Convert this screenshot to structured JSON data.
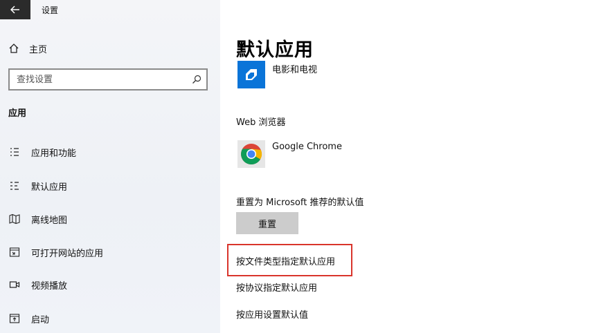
{
  "window": {
    "title": "设置",
    "back_icon": "arrow-left-icon"
  },
  "sidebar": {
    "home_label": "主页",
    "search": {
      "placeholder": "查找设置",
      "value": ""
    },
    "section_title": "应用",
    "items": [
      {
        "id": "apps-features",
        "label": "应用和功能",
        "icon": "list-icon"
      },
      {
        "id": "default-apps",
        "label": "默认应用",
        "icon": "default-apps-icon",
        "active": true
      },
      {
        "id": "offline-maps",
        "label": "离线地图",
        "icon": "map-icon"
      },
      {
        "id": "apps-for-websites",
        "label": "可打开网站的应用",
        "icon": "window-link-icon"
      },
      {
        "id": "video-playback",
        "label": "视频播放",
        "icon": "video-icon"
      },
      {
        "id": "startup",
        "label": "启动",
        "icon": "startup-icon"
      }
    ]
  },
  "main": {
    "title": "默认应用",
    "video_app": "电影和电视",
    "browser_label": "Web 浏览器",
    "browser_app": "Google Chrome",
    "reset_label": "重置为 Microsoft 推荐的默认值",
    "reset_button": "重置",
    "links": {
      "by_file_type": "按文件类型指定默认应用",
      "by_protocol": "按协议指定默认应用",
      "by_app": "按应用设置默认值"
    }
  },
  "colors": {
    "accent": "#0067c0",
    "highlight": "#d9342b",
    "movies_tile": "#0a74d8"
  }
}
